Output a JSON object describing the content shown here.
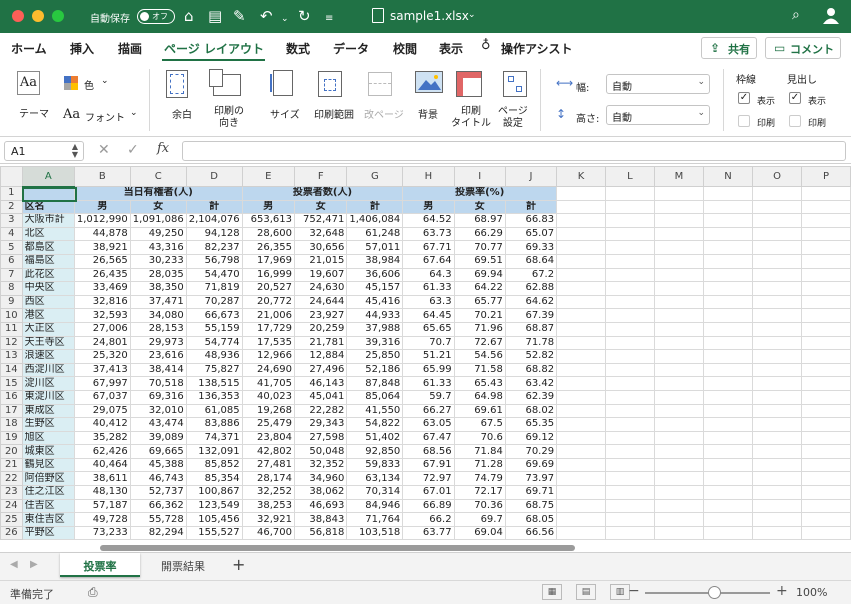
{
  "title_bar": {
    "autosave_label": "自動保存",
    "autosave_state": "オフ",
    "filename": "sample1.xlsx"
  },
  "ribbon_tabs": [
    "ホーム",
    "挿入",
    "描画",
    "ページ レイアウト",
    "数式",
    "データ",
    "校閲",
    "表示",
    "操作アシスト"
  ],
  "active_tab": "ページ レイアウト",
  "share_label": "共有",
  "comment_label": "コメント",
  "ribbon": {
    "theme": "テーマ",
    "color": "色",
    "font": "フォント",
    "margin": "余白",
    "orientation": "印刷の\n向き",
    "size": "サイズ",
    "print_area": "印刷範囲",
    "breaks": "改ページ",
    "background": "背景",
    "print_titles": "印刷\nタイトル",
    "page_setup": "ページ\n設定",
    "width_label": "幅:",
    "width_value": "自動",
    "height_label": "高さ:",
    "height_value": "自動",
    "gridlines_label": "枠線",
    "headings_label": "見出し",
    "view_label": "表示",
    "print_label": "印刷"
  },
  "formula_bar": {
    "cell_ref": "A1",
    "fx": "fx",
    "formula": ""
  },
  "columns": [
    "A",
    "B",
    "C",
    "D",
    "E",
    "F",
    "G",
    "H",
    "I",
    "J",
    "K",
    "L",
    "M",
    "N",
    "O",
    "P"
  ],
  "header_row1": {
    "group1": "当日有権者(人)",
    "group2": "投票者数(人)",
    "group3": "投票率(%)"
  },
  "header_row2": [
    "区名",
    "男",
    "女",
    "計",
    "男",
    "女",
    "計",
    "男",
    "女",
    "計"
  ],
  "rows": [
    [
      "大阪市計",
      "1,012,990",
      "1,091,086",
      "2,104,076",
      "653,613",
      "752,471",
      "1,406,084",
      "64.52",
      "68.97",
      "66.83"
    ],
    [
      "北区",
      "44,878",
      "49,250",
      "94,128",
      "28,600",
      "32,648",
      "61,248",
      "63.73",
      "66.29",
      "65.07"
    ],
    [
      "都島区",
      "38,921",
      "43,316",
      "82,237",
      "26,355",
      "30,656",
      "57,011",
      "67.71",
      "70.77",
      "69.33"
    ],
    [
      "福島区",
      "26,565",
      "30,233",
      "56,798",
      "17,969",
      "21,015",
      "38,984",
      "67.64",
      "69.51",
      "68.64"
    ],
    [
      "此花区",
      "26,435",
      "28,035",
      "54,470",
      "16,999",
      "19,607",
      "36,606",
      "64.3",
      "69.94",
      "67.2"
    ],
    [
      "中央区",
      "33,469",
      "38,350",
      "71,819",
      "20,527",
      "24,630",
      "45,157",
      "61.33",
      "64.22",
      "62.88"
    ],
    [
      "西区",
      "32,816",
      "37,471",
      "70,287",
      "20,772",
      "24,644",
      "45,416",
      "63.3",
      "65.77",
      "64.62"
    ],
    [
      "港区",
      "32,593",
      "34,080",
      "66,673",
      "21,006",
      "23,927",
      "44,933",
      "64.45",
      "70.21",
      "67.39"
    ],
    [
      "大正区",
      "27,006",
      "28,153",
      "55,159",
      "17,729",
      "20,259",
      "37,988",
      "65.65",
      "71.96",
      "68.87"
    ],
    [
      "天王寺区",
      "24,801",
      "29,973",
      "54,774",
      "17,535",
      "21,781",
      "39,316",
      "70.7",
      "72.67",
      "71.78"
    ],
    [
      "浪速区",
      "25,320",
      "23,616",
      "48,936",
      "12,966",
      "12,884",
      "25,850",
      "51.21",
      "54.56",
      "52.82"
    ],
    [
      "西淀川区",
      "37,413",
      "38,414",
      "75,827",
      "24,690",
      "27,496",
      "52,186",
      "65.99",
      "71.58",
      "68.82"
    ],
    [
      "淀川区",
      "67,997",
      "70,518",
      "138,515",
      "41,705",
      "46,143",
      "87,848",
      "61.33",
      "65.43",
      "63.42"
    ],
    [
      "東淀川区",
      "67,037",
      "69,316",
      "136,353",
      "40,023",
      "45,041",
      "85,064",
      "59.7",
      "64.98",
      "62.39"
    ],
    [
      "東成区",
      "29,075",
      "32,010",
      "61,085",
      "19,268",
      "22,282",
      "41,550",
      "66.27",
      "69.61",
      "68.02"
    ],
    [
      "生野区",
      "40,412",
      "43,474",
      "83,886",
      "25,479",
      "29,343",
      "54,822",
      "63.05",
      "67.5",
      "65.35"
    ],
    [
      "旭区",
      "35,282",
      "39,089",
      "74,371",
      "23,804",
      "27,598",
      "51,402",
      "67.47",
      "70.6",
      "69.12"
    ],
    [
      "城東区",
      "62,426",
      "69,665",
      "132,091",
      "42,802",
      "50,048",
      "92,850",
      "68.56",
      "71.84",
      "70.29"
    ],
    [
      "鶴見区",
      "40,464",
      "45,388",
      "85,852",
      "27,481",
      "32,352",
      "59,833",
      "67.91",
      "71.28",
      "69.69"
    ],
    [
      "阿倍野区",
      "38,611",
      "46,743",
      "85,354",
      "28,174",
      "34,960",
      "63,134",
      "72.97",
      "74.79",
      "73.97"
    ],
    [
      "住之江区",
      "48,130",
      "52,737",
      "100,867",
      "32,252",
      "38,062",
      "70,314",
      "67.01",
      "72.17",
      "69.71"
    ],
    [
      "住吉区",
      "57,187",
      "66,362",
      "123,549",
      "38,253",
      "46,693",
      "84,946",
      "66.89",
      "70.36",
      "68.75"
    ],
    [
      "東住吉区",
      "49,728",
      "55,728",
      "105,456",
      "32,921",
      "38,843",
      "71,764",
      "66.2",
      "69.7",
      "68.05"
    ],
    [
      "平野区",
      "73,233",
      "82,294",
      "155,527",
      "46,700",
      "56,818",
      "103,518",
      "63.77",
      "69.04",
      "66.56"
    ]
  ],
  "sheet_tabs": [
    "投票率",
    "開票結果"
  ],
  "active_sheet": "投票率",
  "status": {
    "text": "準備完了",
    "zoom": "100%"
  }
}
